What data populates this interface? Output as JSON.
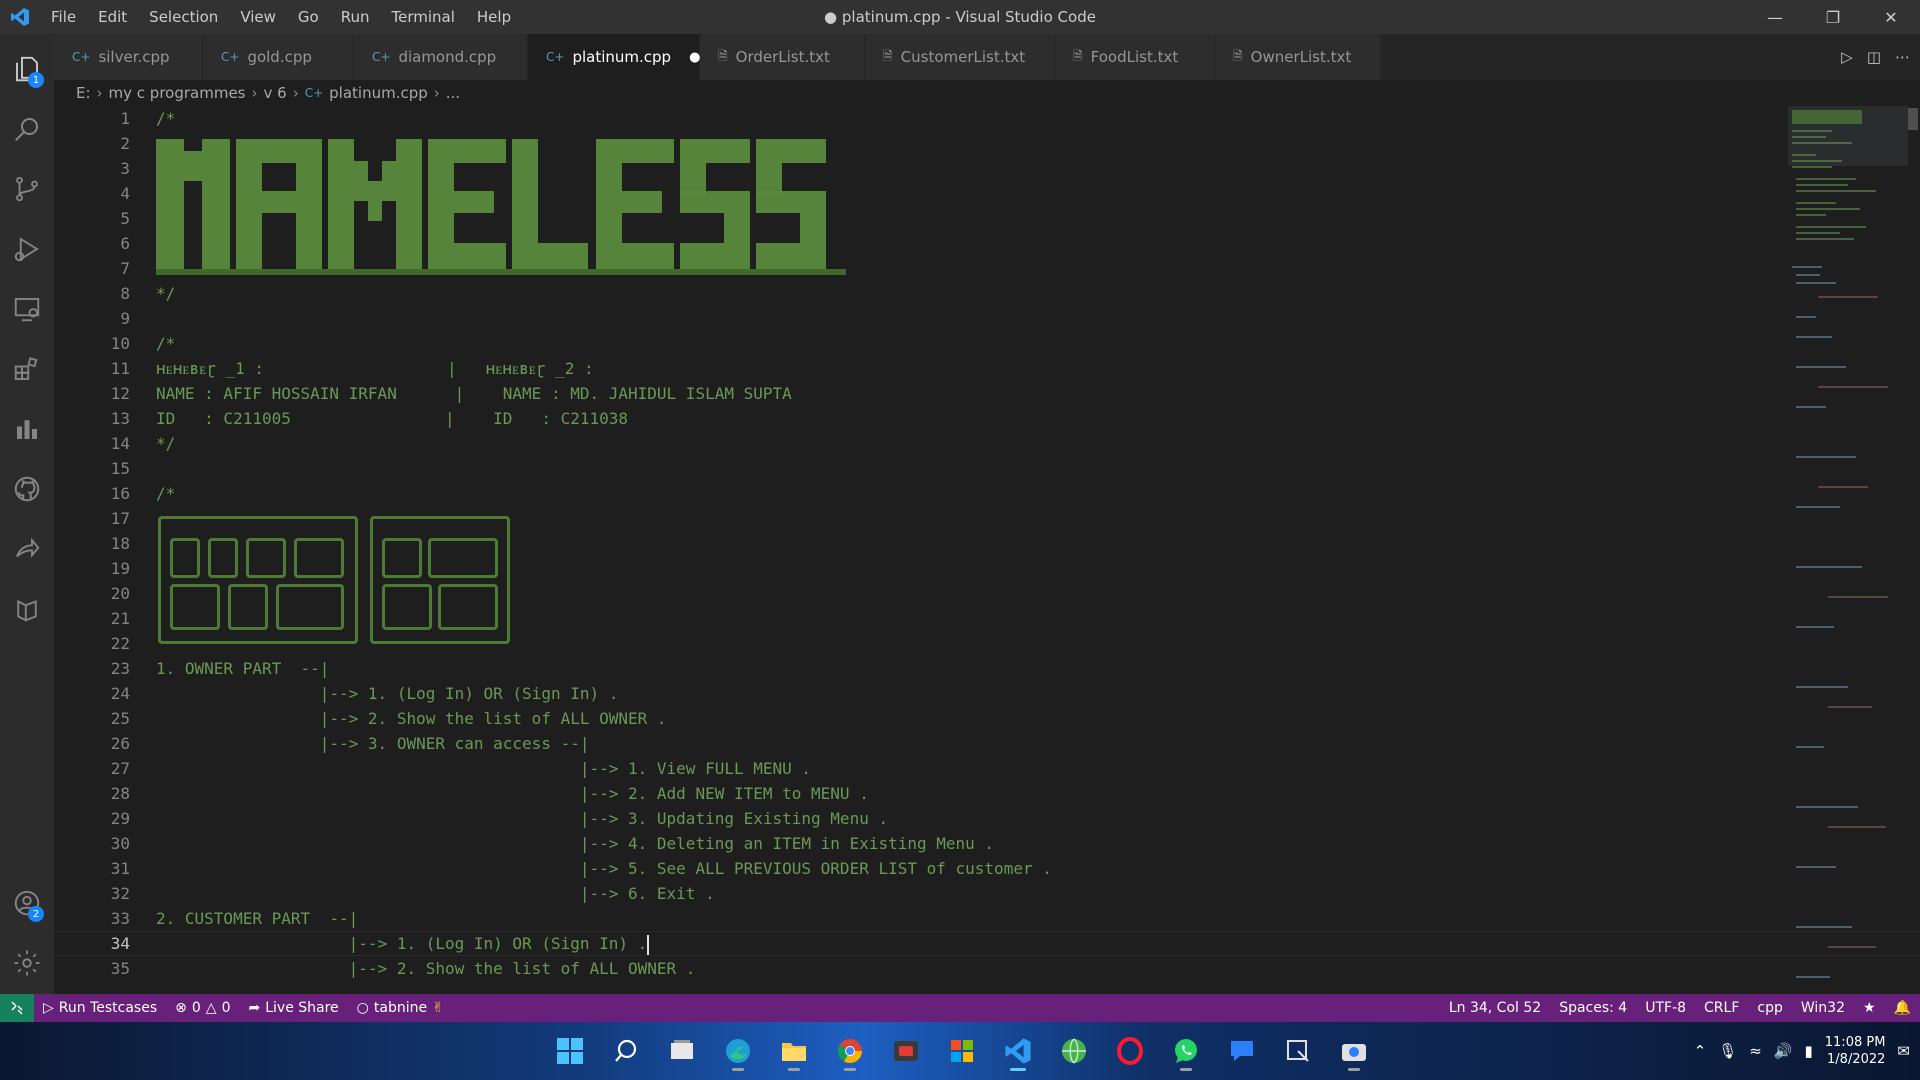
{
  "window": {
    "title": "● platinum.cpp - Visual Studio Code",
    "menu": [
      "File",
      "Edit",
      "Selection",
      "View",
      "Go",
      "Run",
      "Terminal",
      "Help"
    ]
  },
  "activity_bar": {
    "explorer_badge": "1",
    "accounts_badge": "2"
  },
  "tabs": [
    {
      "label": "silver.cpp",
      "icon": "cpp-file-icon"
    },
    {
      "label": "gold.cpp",
      "icon": "cpp-file-icon"
    },
    {
      "label": "diamond.cpp",
      "icon": "cpp-file-icon"
    },
    {
      "label": "platinum.cpp",
      "icon": "cpp-file-icon",
      "active": true,
      "dirty": "●"
    },
    {
      "label": "OrderList.txt",
      "icon": "text-file-icon"
    },
    {
      "label": "CustomerList.txt",
      "icon": "text-file-icon"
    },
    {
      "label": "FoodList.txt",
      "icon": "text-file-icon"
    },
    {
      "label": "OwnerList.txt",
      "icon": "text-file-icon"
    }
  ],
  "breadcrumb": [
    "E:",
    "my c programmes",
    "v 6",
    "platinum.cpp",
    "..."
  ],
  "editor": {
    "line_numbers": [
      "1",
      "2",
      "3",
      "4",
      "5",
      "6",
      "7",
      "8",
      "9",
      "10",
      "11",
      "12",
      "13",
      "14",
      "15",
      "16",
      "17",
      "18",
      "19",
      "20",
      "21",
      "22",
      "23",
      "24",
      "25",
      "26",
      "27",
      "28",
      "29",
      "30",
      "31",
      "32",
      "33",
      "34",
      "35"
    ],
    "current_line": "34",
    "lines": [
      "/*",
      "",
      "",
      "",
      "",
      "",
      "",
      "*/",
      "",
      "/*",
      "ʜᴇʜᴇʙᴇɽ _1 :                   |   ʜᴇʜᴇʙᴇɽ _2 :",
      "NAME : AFIF HOSSAIN IRFAN      |    NAME : MD. JAHIDUL ISLAM SUPTA",
      "ID   : C211005                |    ID   : C211038",
      "*/",
      "",
      "/*",
      "",
      "",
      "",
      "",
      "",
      "",
      "1. OWNER PART  --|",
      "                 |--> 1. (Log In) OR (Sign In) .",
      "                 |--> 2. Show the list of ALL OWNER .",
      "                 |--> 3. OWNER can access --|",
      "                                            |--> 1. View FULL MENU .",
      "                                            |--> 2. Add NEW ITEM to MENU .",
      "                                            |--> 3. Updating Existing Menu .",
      "                                            |--> 4. Deleting an ITEM in Existing Menu .",
      "                                            |--> 5. See ALL PREVIOUS ORDER LIST of customer .",
      "                                            |--> 6. Exit .",
      "2. CUSTOMER PART  --|",
      "                    |--> 1. (Log In) OR (Sign In) .",
      "                    |--> 2. Show the list of ALL OWNER ."
    ]
  },
  "status_bar": {
    "run_testcases": "Run Testcases",
    "errors": "0",
    "warnings": "0",
    "live_share": "Live Share",
    "tabnine": "tabnine",
    "position": "Ln 34, Col 52",
    "spaces": "Spaces: 4",
    "encoding": "UTF-8",
    "eol": "CRLF",
    "language": "cpp",
    "platform": "Win32"
  },
  "taskbar": {
    "time": "11:08 PM",
    "date": "1/8/2022"
  },
  "colors": {
    "editor_bg": "#1e1e1e",
    "comment": "#6a9955",
    "status_bar": "#68217a",
    "activity_bar": "#2c2c2c"
  }
}
